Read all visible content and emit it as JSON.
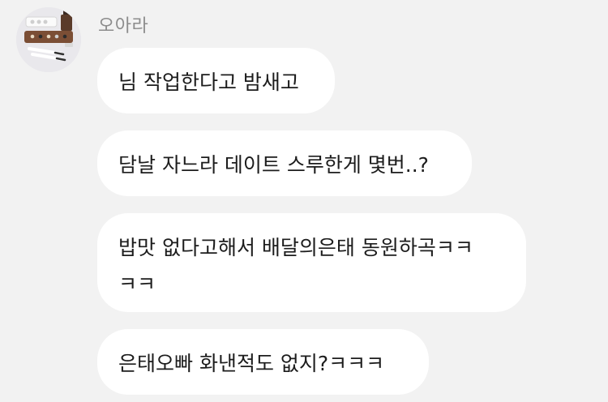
{
  "sender": {
    "name": "오아라"
  },
  "messages": [
    {
      "text": "님 작업한다고 밤새고"
    },
    {
      "text": "담날 자느라 데이트 스루한게 몇번..?"
    },
    {
      "line1": "밥맛 없다고해서 배달의은태 동원하곡ㅋㅋ",
      "line2": "ㅋㅋ"
    },
    {
      "text": "은태오빠 화낸적도 없지?ㅋㅋㅋ"
    }
  ],
  "colors": {
    "background": "#f2f2f2",
    "bubble": "#ffffff",
    "text": "#1c1c1c",
    "name": "#8c8c8c"
  }
}
